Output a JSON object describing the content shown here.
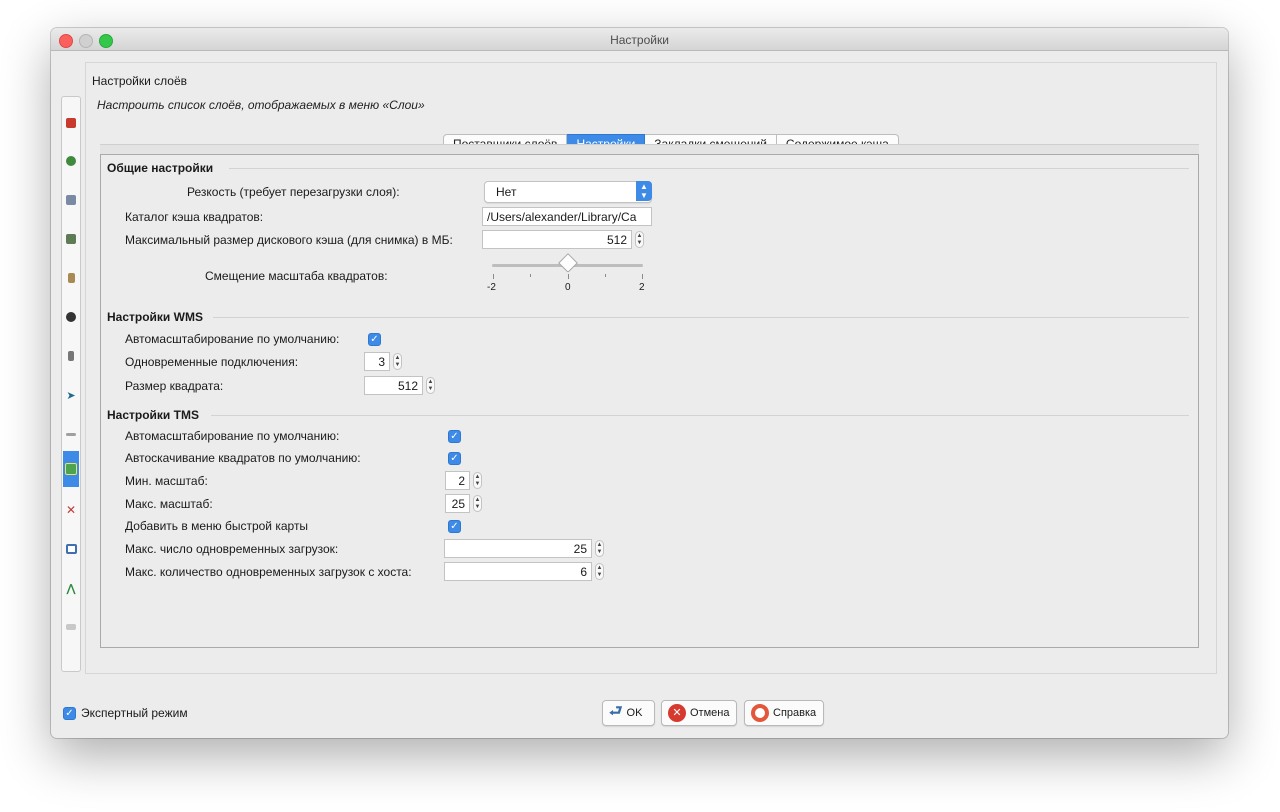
{
  "window": {
    "title": "Настройки"
  },
  "sidebar": {
    "items": [
      {
        "icon": "layer-red-icon",
        "color": "#c83a2c"
      },
      {
        "icon": "globe-icon",
        "color": "#3f8a3f"
      },
      {
        "icon": "map-grid-icon",
        "color": "#7a8aa5"
      },
      {
        "icon": "connection-icon",
        "color": "#5d7c56"
      },
      {
        "icon": "keyboard-icon",
        "color": "#a88a52"
      },
      {
        "icon": "plugin-icon",
        "color": "#333333"
      },
      {
        "icon": "font-icon",
        "color": "#555555"
      },
      {
        "icon": "arrow-icon",
        "color": "#1f6b8a"
      },
      {
        "icon": "small-text-icon",
        "color": "#8a8a8a"
      },
      {
        "icon": "map-settings-icon",
        "color": "#4da44d"
      },
      {
        "icon": "tools-icon",
        "color": "#c03b3b"
      },
      {
        "icon": "display-icon",
        "color": "#3f6fb0"
      },
      {
        "icon": "validation-icon",
        "color": "#2e8a3e"
      },
      {
        "icon": "misc-icon",
        "color": "#b5b5b5"
      }
    ]
  },
  "header": {
    "title": "Настройки слоёв",
    "subtitle": "Настроить список слоёв, отображаемых в меню «Слои»"
  },
  "tabs": [
    {
      "label": "Поставщики слоёв",
      "active": false
    },
    {
      "label": "Настройки",
      "active": true
    },
    {
      "label": "Закладки смещений",
      "active": false
    },
    {
      "label": "Содержимое кэша",
      "active": false
    }
  ],
  "general": {
    "title": "Общие настройки",
    "sharpness_label": "Резкость (требует перезагрузки слоя):",
    "sharpness_value": "Нет",
    "cache_dir_label": "Каталог кэша квадратов:",
    "cache_dir_value": "/Users/alexander/Library/Ca",
    "max_cache_label": "Максимальный размер дискового кэша (для снимка) в МБ:",
    "max_cache_value": "512",
    "zoom_offset_label": "Смещение масштаба квадратов:",
    "zoom_offset_ticks": [
      "-2",
      "0",
      "2"
    ],
    "zoom_offset_min": -2,
    "zoom_offset_max": 2,
    "zoom_offset_value": 0
  },
  "wms": {
    "title": "Настройки WMS",
    "autozoom_label": "Автомасштабирование по умолчанию:",
    "autozoom_checked": true,
    "connections_label": "Одновременные подключения:",
    "connections_value": "3",
    "tile_size_label": "Размер квадрата:",
    "tile_size_value": "512"
  },
  "tms": {
    "title": "Настройки TMS",
    "autozoom_label": "Автомасштабирование по умолчанию:",
    "autozoom_checked": true,
    "autoload_label": "Автоскачивание квадратов по умолчанию:",
    "autoload_checked": true,
    "min_zoom_label": "Мин. масштаб:",
    "min_zoom_value": "2",
    "max_zoom_label": "Макс. масштаб:",
    "max_zoom_value": "25",
    "quick_menu_label": "Добавить в меню быстрой карты",
    "quick_menu_checked": true,
    "max_downloads_label": "Макс. число одновременных загрузок:",
    "max_downloads_value": "25",
    "max_host_label": "Макс. количество одновременных загрузок с хоста:",
    "max_host_value": "6"
  },
  "footer": {
    "expert_label": "Экспертный режим",
    "expert_checked": true,
    "ok_label": "OK",
    "cancel_label": "Отмена",
    "help_label": "Справка"
  },
  "colors": {
    "accent": "#3d8be6",
    "window_bg": "#ececec"
  }
}
